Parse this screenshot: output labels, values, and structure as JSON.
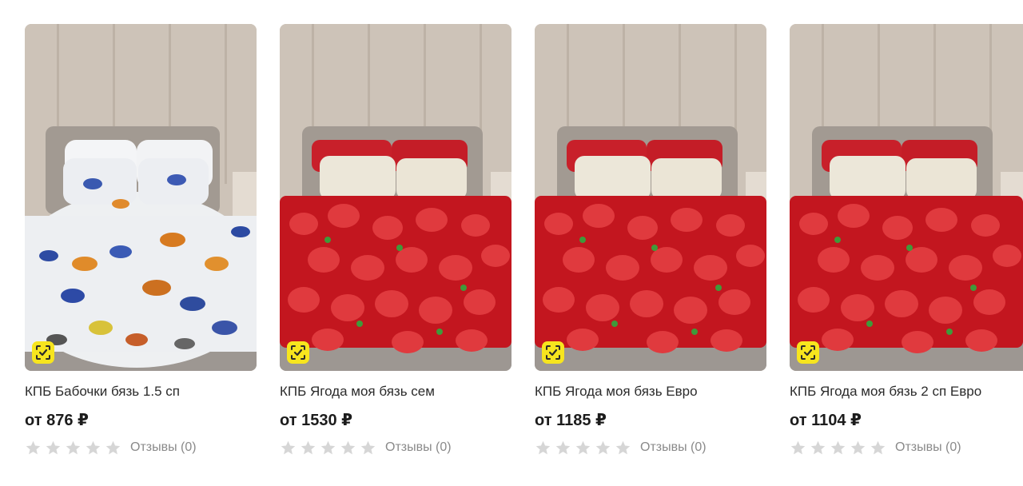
{
  "colors": {
    "badge_yellow": "#f7e51e",
    "star_gray": "#d6d6d6",
    "text": "#2b2b2b",
    "muted": "#8a8a8a"
  },
  "products": [
    {
      "title": "КПБ Бабочки бязь 1.5 сп",
      "price": "от 876 ₽",
      "rating": 0,
      "reviews": "Отзывы (0)",
      "image": "bed-butterflies-photo",
      "badge_icon": "verified-check-icon"
    },
    {
      "title": "КПБ Ягода моя бязь сем",
      "price": "от 1530 ₽",
      "rating": 0,
      "reviews": "Отзывы (0)",
      "image": "bed-strawberries-photo",
      "badge_icon": "verified-check-icon"
    },
    {
      "title": "КПБ Ягода моя бязь Евро",
      "price": "от 1185 ₽",
      "rating": 0,
      "reviews": "Отзывы (0)",
      "image": "bed-strawberries-photo",
      "badge_icon": "verified-check-icon"
    },
    {
      "title": "КПБ Ягода моя бязь 2 сп Евро",
      "price": "от 1104 ₽",
      "rating": 0,
      "reviews": "Отзывы (0)",
      "image": "bed-strawberries-photo",
      "badge_icon": "verified-check-icon"
    }
  ]
}
